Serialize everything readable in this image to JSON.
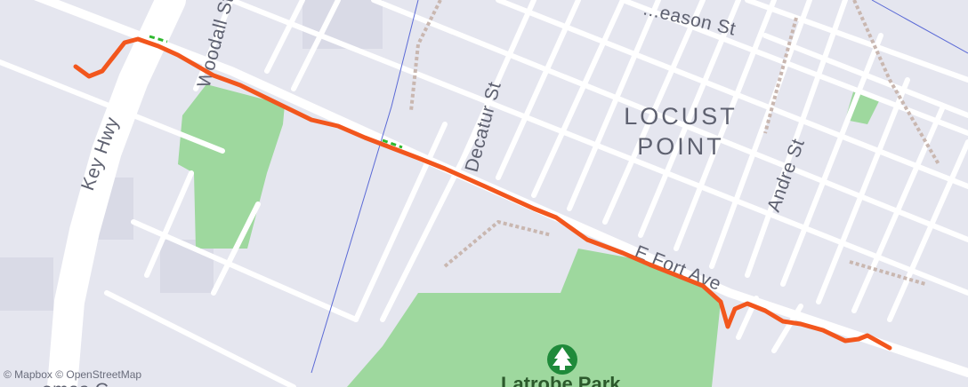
{
  "map": {
    "area_label": {
      "line1": "LOCUST",
      "line2": "POINT"
    },
    "streets": {
      "key_hwy": "Key Hwy",
      "woodall": "Woodall St",
      "decatur": "Decatur St",
      "andre": "Andre St",
      "fort_ave": "E Fort Ave",
      "season": "...eason St",
      "bottom_left": "...omas C..."
    },
    "park": {
      "name": "Latrobe Park",
      "icon": "tree-icon"
    },
    "attribution": "© Mapbox © OpenStreetMap",
    "route": {
      "color": "#f2561d"
    },
    "colors": {
      "background": "#e5e6ef",
      "road": "#ffffff",
      "park": "#9ed89e",
      "water": "#8ecbea",
      "park_marker": "#1f8a3a"
    }
  }
}
